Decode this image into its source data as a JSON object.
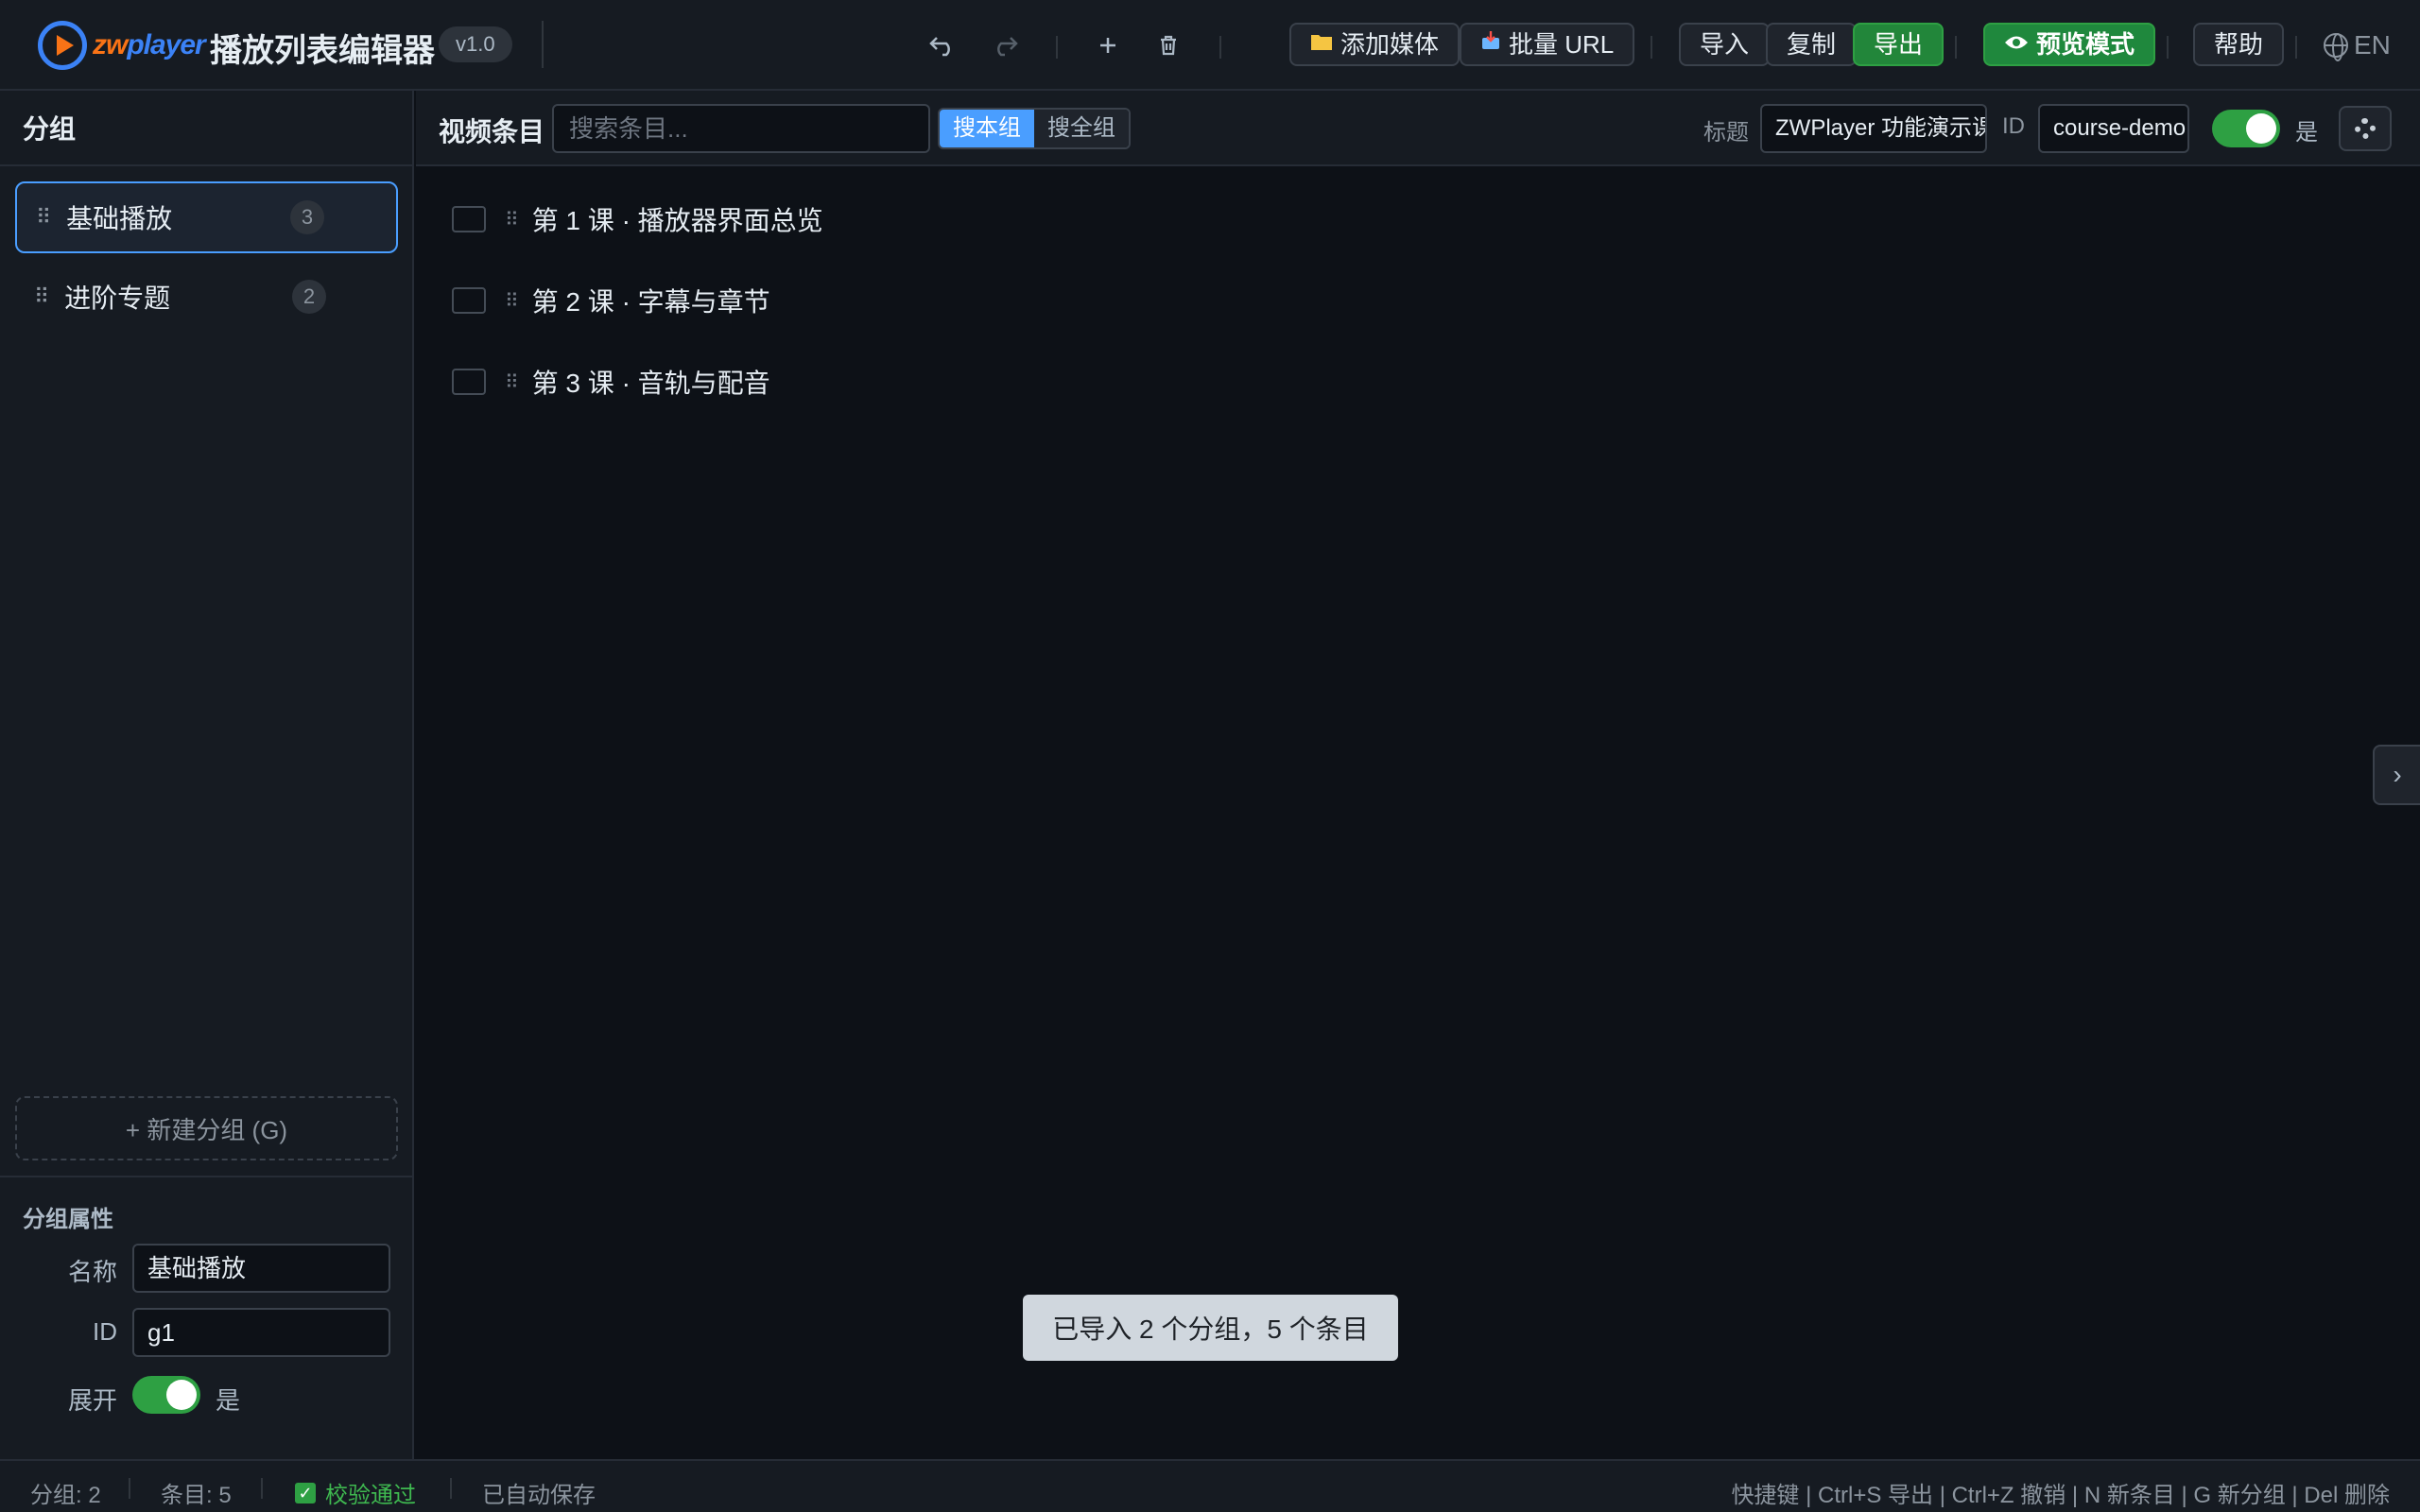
{
  "header": {
    "logo_text_a": "zw",
    "logo_text_b": "player",
    "title": "播放列表编辑器",
    "version": "v1.0",
    "add_media": "添加媒体",
    "batch_url": "批量 URL",
    "import": "导入",
    "copy": "复制",
    "export": "导出",
    "preview": "预览模式",
    "help": "帮助",
    "language": "EN"
  },
  "sidebar": {
    "heading": "分组",
    "groups": [
      {
        "name": "基础播放",
        "count": "3"
      },
      {
        "name": "进阶专题",
        "count": "2"
      }
    ],
    "new_group": "+ 新建分组 (G)",
    "props": {
      "title": "分组属性",
      "name_label": "名称",
      "name_value": "基础播放",
      "id_label": "ID",
      "id_value": "g1",
      "expand_label": "展开",
      "expand_value": "是"
    }
  },
  "main": {
    "title": "视频条目",
    "search_placeholder": "搜索条目...",
    "scope_group": "搜本组",
    "scope_all": "搜全组",
    "meta_title_label": "标题",
    "meta_title_value": "ZWPlayer 功能演示课",
    "meta_id_label": "ID",
    "meta_id_value": "course-demo",
    "toggle_text": "是",
    "items": [
      {
        "title": "第 1 课 · 播放器界面总览"
      },
      {
        "title": "第 2 课 · 字幕与章节"
      },
      {
        "title": "第 3 课 · 音轨与配音"
      }
    ],
    "collapse_arrow": "›"
  },
  "toast": "已导入 2 个分组，5 个条目",
  "status": {
    "groups": "分组: 2",
    "items": "条目: 5",
    "validation": "校验通过",
    "autosave": "已自动保存",
    "shortcuts": "快捷键 | Ctrl+S 导出 | Ctrl+Z 撤销 | N 新条目 | G 新分组 | Del 删除"
  },
  "colors": {
    "accent": "#4a9eff",
    "success": "#2ea043",
    "background": "#0d1117",
    "panel": "#161b22"
  },
  "icons": {
    "undo": "undo-icon",
    "redo": "redo-icon",
    "add": "plus-icon",
    "delete": "trash-icon",
    "folder": "folder-icon",
    "inbox": "inbox-icon",
    "eye": "eye-icon",
    "globe": "globe-icon",
    "gear": "gear-icon"
  }
}
